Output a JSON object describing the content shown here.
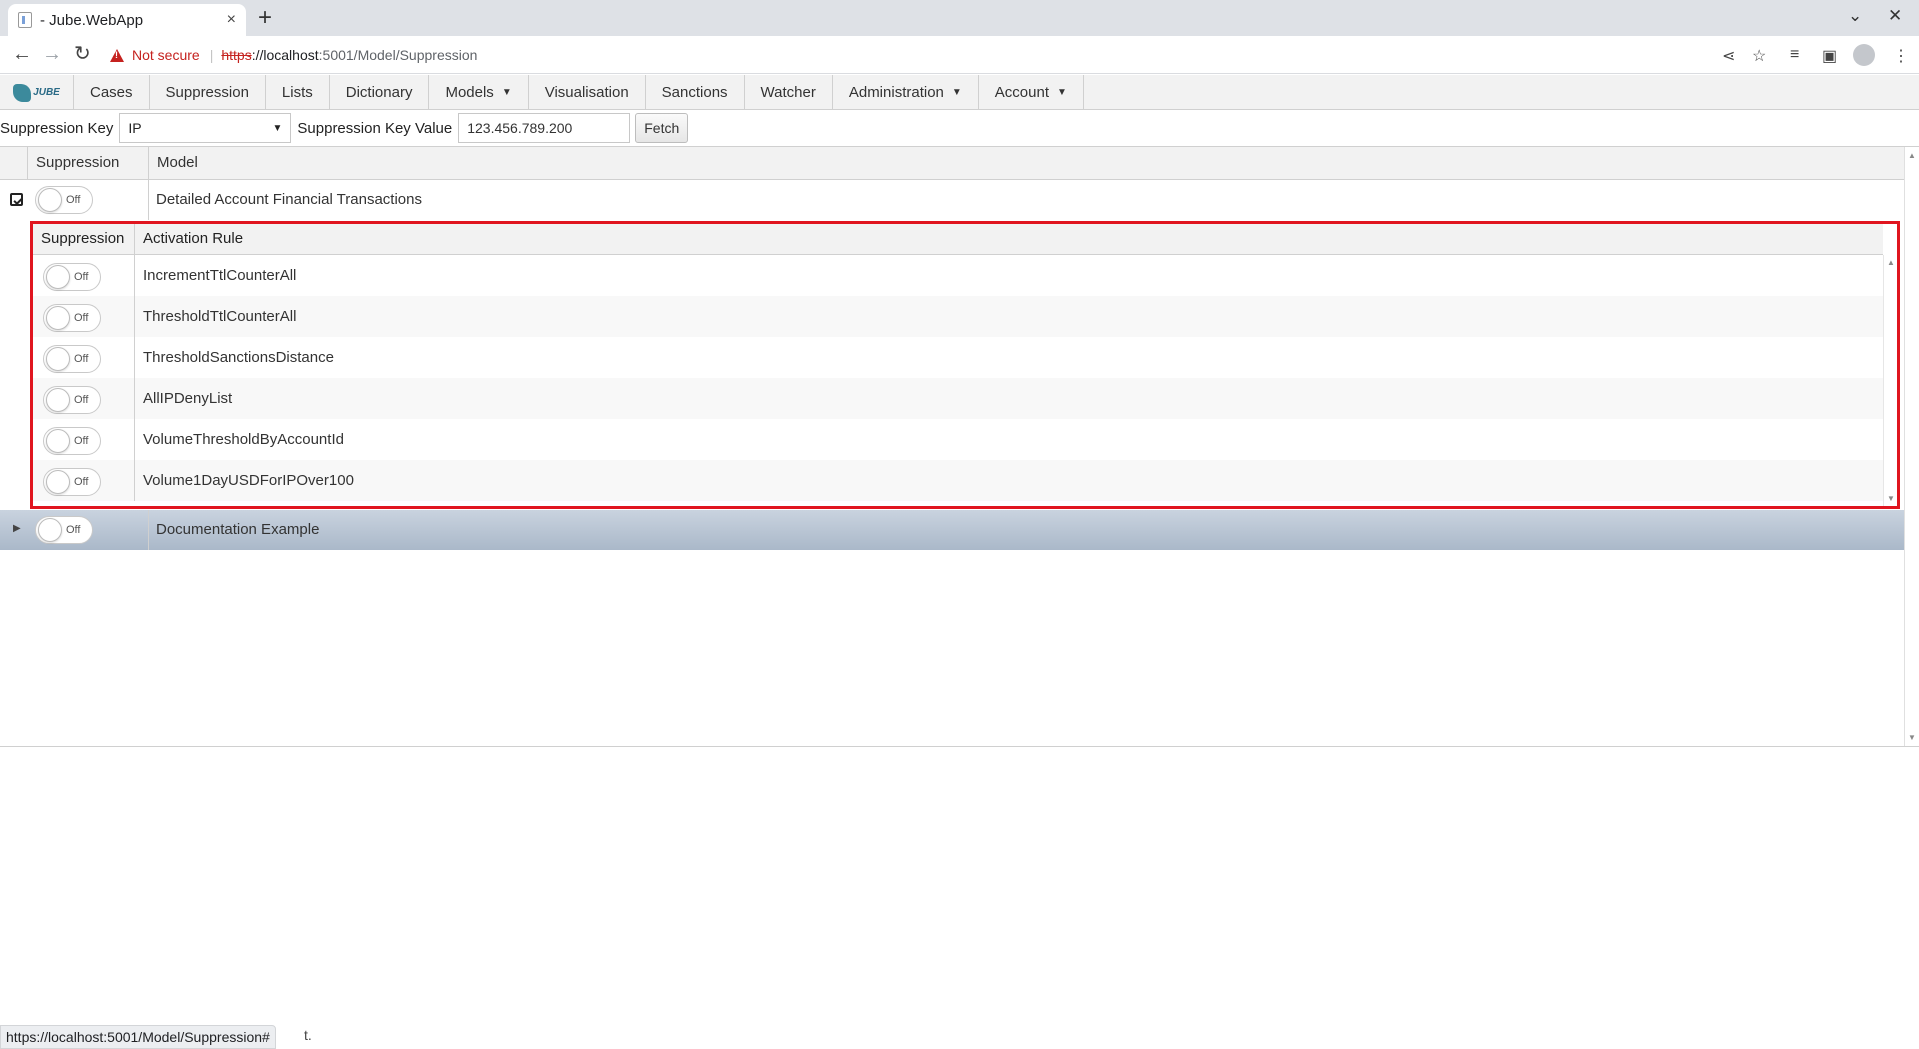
{
  "browser": {
    "tab_title": "- Jube.WebApp",
    "tab_close": "×",
    "new_tab": "+",
    "security_label": "Not secure",
    "url_scheme": "https",
    "url_host": "://localhost",
    "url_path": ":5001/Model/Suppression",
    "status_url": "https://localhost:5001/Model/Suppression#",
    "status_tail": "t."
  },
  "menu": {
    "logo_text": "JUBE",
    "items": [
      {
        "label": "Cases",
        "dropdown": false
      },
      {
        "label": "Suppression",
        "dropdown": false
      },
      {
        "label": "Lists",
        "dropdown": false
      },
      {
        "label": "Dictionary",
        "dropdown": false
      },
      {
        "label": "Models",
        "dropdown": true
      },
      {
        "label": "Visualisation",
        "dropdown": false
      },
      {
        "label": "Sanctions",
        "dropdown": false
      },
      {
        "label": "Watcher",
        "dropdown": false
      },
      {
        "label": "Administration",
        "dropdown": true
      },
      {
        "label": "Account",
        "dropdown": true
      }
    ]
  },
  "filter": {
    "key_label": "Suppression Key",
    "key_value": "IP",
    "value_label": "Suppression Key Value",
    "value_input": "123.456.789.200",
    "fetch_label": "Fetch"
  },
  "grid": {
    "headers": {
      "suppression": "Suppression",
      "model": "Model"
    },
    "rows": [
      {
        "model": "Detailed Account Financial Transactions",
        "toggle": "Off",
        "expanded": true
      },
      {
        "model": "Documentation Example",
        "toggle": "Off",
        "expanded": false,
        "selected": true
      }
    ]
  },
  "subgrid": {
    "headers": {
      "suppression": "Suppression",
      "rule": "Activation Rule"
    },
    "rows": [
      {
        "rule": "IncrementTtlCounterAll",
        "toggle": "Off"
      },
      {
        "rule": "ThresholdTtlCounterAll",
        "toggle": "Off"
      },
      {
        "rule": "ThresholdSanctionsDistance",
        "toggle": "Off"
      },
      {
        "rule": "AllIPDenyList",
        "toggle": "Off"
      },
      {
        "rule": "VolumeThresholdByAccountId",
        "toggle": "Off"
      },
      {
        "rule": "Volume1DayUSDForIPOver100",
        "toggle": "Off"
      }
    ]
  },
  "colors": {
    "highlight_border": "#e0151f",
    "selected_row": "#b7c3d2",
    "warning": "#c5221f"
  }
}
